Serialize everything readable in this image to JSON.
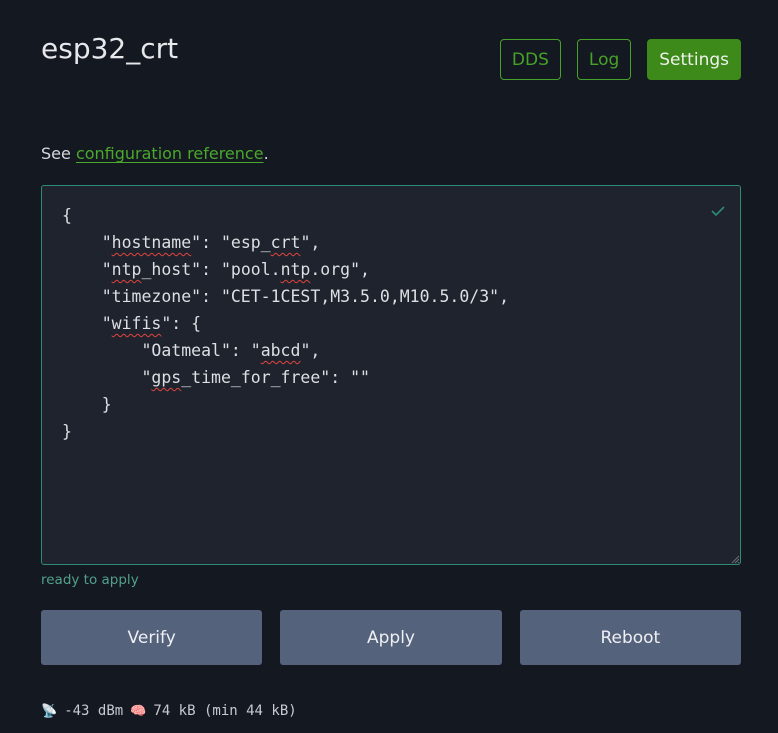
{
  "header": {
    "title": "esp32_crt",
    "nav": [
      {
        "label": "DDS",
        "active": false
      },
      {
        "label": "Log",
        "active": false
      },
      {
        "label": "Settings",
        "active": true
      }
    ]
  },
  "reference": {
    "prefix": "See ",
    "link_text": "configuration reference",
    "suffix": "."
  },
  "editor": {
    "lines": [
      "{",
      "    \"hostname\": \"esp_crt\",",
      "    \"ntp_host\": \"pool.ntp.org\",",
      "    \"timezone\": \"CET-1CEST,M3.5.0,M10.5.0/3\",",
      "    \"wifis\": {",
      "        \"Oatmeal\": \"abcd\",",
      "        \"gps_time_for_free\": \"\"",
      "    }",
      "}"
    ],
    "valid_icon": "check-icon"
  },
  "status": "ready to apply",
  "actions": {
    "verify": "Verify",
    "apply": "Apply",
    "reboot": "Reboot"
  },
  "footer": {
    "signal_icon": "📡",
    "signal": "-43 dBm",
    "memory_icon": "🧠",
    "memory": "74 kB (min 44 kB)"
  },
  "colors": {
    "accent": "#46a228",
    "accent_active": "#3d8a1a",
    "editor_border": "#2d8c78",
    "status": "#52a08a",
    "button": "#55627c",
    "background": "#141821"
  }
}
